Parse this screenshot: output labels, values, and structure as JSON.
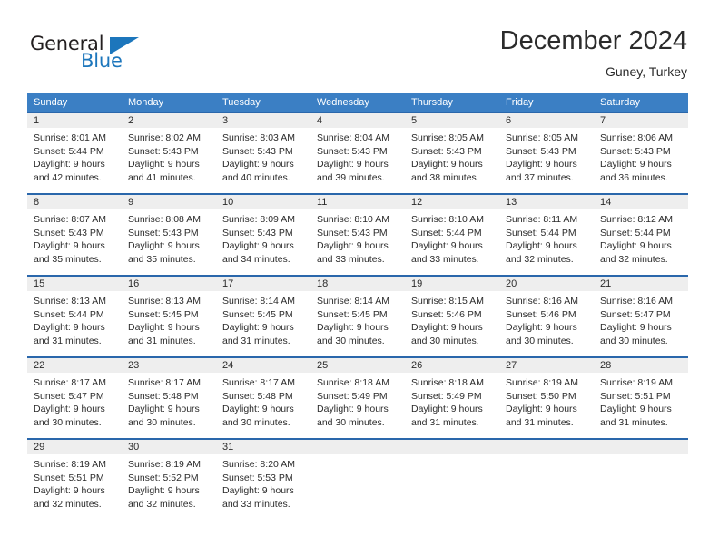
{
  "logo": {
    "word_top": "General",
    "word_bottom": "Blue",
    "triangle_color": "#1c76bc",
    "text_color": "#231f20"
  },
  "header": {
    "title": "December 2024",
    "location": "Guney, Turkey"
  },
  "theme": {
    "header_blue": "#3b7fc4",
    "cell_border_blue": "#2a67ab",
    "numband_gray": "#eeeeee",
    "text_color": "#2b2b2b"
  },
  "weekdays": [
    "Sunday",
    "Monday",
    "Tuesday",
    "Wednesday",
    "Thursday",
    "Friday",
    "Saturday"
  ],
  "weeks": [
    [
      {
        "day": "1",
        "sunrise": "Sunrise: 8:01 AM",
        "sunset": "Sunset: 5:44 PM",
        "daylight1": "Daylight: 9 hours",
        "daylight2": "and 42 minutes."
      },
      {
        "day": "2",
        "sunrise": "Sunrise: 8:02 AM",
        "sunset": "Sunset: 5:43 PM",
        "daylight1": "Daylight: 9 hours",
        "daylight2": "and 41 minutes."
      },
      {
        "day": "3",
        "sunrise": "Sunrise: 8:03 AM",
        "sunset": "Sunset: 5:43 PM",
        "daylight1": "Daylight: 9 hours",
        "daylight2": "and 40 minutes."
      },
      {
        "day": "4",
        "sunrise": "Sunrise: 8:04 AM",
        "sunset": "Sunset: 5:43 PM",
        "daylight1": "Daylight: 9 hours",
        "daylight2": "and 39 minutes."
      },
      {
        "day": "5",
        "sunrise": "Sunrise: 8:05 AM",
        "sunset": "Sunset: 5:43 PM",
        "daylight1": "Daylight: 9 hours",
        "daylight2": "and 38 minutes."
      },
      {
        "day": "6",
        "sunrise": "Sunrise: 8:05 AM",
        "sunset": "Sunset: 5:43 PM",
        "daylight1": "Daylight: 9 hours",
        "daylight2": "and 37 minutes."
      },
      {
        "day": "7",
        "sunrise": "Sunrise: 8:06 AM",
        "sunset": "Sunset: 5:43 PM",
        "daylight1": "Daylight: 9 hours",
        "daylight2": "and 36 minutes."
      }
    ],
    [
      {
        "day": "8",
        "sunrise": "Sunrise: 8:07 AM",
        "sunset": "Sunset: 5:43 PM",
        "daylight1": "Daylight: 9 hours",
        "daylight2": "and 35 minutes."
      },
      {
        "day": "9",
        "sunrise": "Sunrise: 8:08 AM",
        "sunset": "Sunset: 5:43 PM",
        "daylight1": "Daylight: 9 hours",
        "daylight2": "and 35 minutes."
      },
      {
        "day": "10",
        "sunrise": "Sunrise: 8:09 AM",
        "sunset": "Sunset: 5:43 PM",
        "daylight1": "Daylight: 9 hours",
        "daylight2": "and 34 minutes."
      },
      {
        "day": "11",
        "sunrise": "Sunrise: 8:10 AM",
        "sunset": "Sunset: 5:43 PM",
        "daylight1": "Daylight: 9 hours",
        "daylight2": "and 33 minutes."
      },
      {
        "day": "12",
        "sunrise": "Sunrise: 8:10 AM",
        "sunset": "Sunset: 5:44 PM",
        "daylight1": "Daylight: 9 hours",
        "daylight2": "and 33 minutes."
      },
      {
        "day": "13",
        "sunrise": "Sunrise: 8:11 AM",
        "sunset": "Sunset: 5:44 PM",
        "daylight1": "Daylight: 9 hours",
        "daylight2": "and 32 minutes."
      },
      {
        "day": "14",
        "sunrise": "Sunrise: 8:12 AM",
        "sunset": "Sunset: 5:44 PM",
        "daylight1": "Daylight: 9 hours",
        "daylight2": "and 32 minutes."
      }
    ],
    [
      {
        "day": "15",
        "sunrise": "Sunrise: 8:13 AM",
        "sunset": "Sunset: 5:44 PM",
        "daylight1": "Daylight: 9 hours",
        "daylight2": "and 31 minutes."
      },
      {
        "day": "16",
        "sunrise": "Sunrise: 8:13 AM",
        "sunset": "Sunset: 5:45 PM",
        "daylight1": "Daylight: 9 hours",
        "daylight2": "and 31 minutes."
      },
      {
        "day": "17",
        "sunrise": "Sunrise: 8:14 AM",
        "sunset": "Sunset: 5:45 PM",
        "daylight1": "Daylight: 9 hours",
        "daylight2": "and 31 minutes."
      },
      {
        "day": "18",
        "sunrise": "Sunrise: 8:14 AM",
        "sunset": "Sunset: 5:45 PM",
        "daylight1": "Daylight: 9 hours",
        "daylight2": "and 30 minutes."
      },
      {
        "day": "19",
        "sunrise": "Sunrise: 8:15 AM",
        "sunset": "Sunset: 5:46 PM",
        "daylight1": "Daylight: 9 hours",
        "daylight2": "and 30 minutes."
      },
      {
        "day": "20",
        "sunrise": "Sunrise: 8:16 AM",
        "sunset": "Sunset: 5:46 PM",
        "daylight1": "Daylight: 9 hours",
        "daylight2": "and 30 minutes."
      },
      {
        "day": "21",
        "sunrise": "Sunrise: 8:16 AM",
        "sunset": "Sunset: 5:47 PM",
        "daylight1": "Daylight: 9 hours",
        "daylight2": "and 30 minutes."
      }
    ],
    [
      {
        "day": "22",
        "sunrise": "Sunrise: 8:17 AM",
        "sunset": "Sunset: 5:47 PM",
        "daylight1": "Daylight: 9 hours",
        "daylight2": "and 30 minutes."
      },
      {
        "day": "23",
        "sunrise": "Sunrise: 8:17 AM",
        "sunset": "Sunset: 5:48 PM",
        "daylight1": "Daylight: 9 hours",
        "daylight2": "and 30 minutes."
      },
      {
        "day": "24",
        "sunrise": "Sunrise: 8:17 AM",
        "sunset": "Sunset: 5:48 PM",
        "daylight1": "Daylight: 9 hours",
        "daylight2": "and 30 minutes."
      },
      {
        "day": "25",
        "sunrise": "Sunrise: 8:18 AM",
        "sunset": "Sunset: 5:49 PM",
        "daylight1": "Daylight: 9 hours",
        "daylight2": "and 30 minutes."
      },
      {
        "day": "26",
        "sunrise": "Sunrise: 8:18 AM",
        "sunset": "Sunset: 5:49 PM",
        "daylight1": "Daylight: 9 hours",
        "daylight2": "and 31 minutes."
      },
      {
        "day": "27",
        "sunrise": "Sunrise: 8:19 AM",
        "sunset": "Sunset: 5:50 PM",
        "daylight1": "Daylight: 9 hours",
        "daylight2": "and 31 minutes."
      },
      {
        "day": "28",
        "sunrise": "Sunrise: 8:19 AM",
        "sunset": "Sunset: 5:51 PM",
        "daylight1": "Daylight: 9 hours",
        "daylight2": "and 31 minutes."
      }
    ],
    [
      {
        "day": "29",
        "sunrise": "Sunrise: 8:19 AM",
        "sunset": "Sunset: 5:51 PM",
        "daylight1": "Daylight: 9 hours",
        "daylight2": "and 32 minutes."
      },
      {
        "day": "30",
        "sunrise": "Sunrise: 8:19 AM",
        "sunset": "Sunset: 5:52 PM",
        "daylight1": "Daylight: 9 hours",
        "daylight2": "and 32 minutes."
      },
      {
        "day": "31",
        "sunrise": "Sunrise: 8:20 AM",
        "sunset": "Sunset: 5:53 PM",
        "daylight1": "Daylight: 9 hours",
        "daylight2": "and 33 minutes."
      },
      {
        "day": "",
        "sunrise": "",
        "sunset": "",
        "daylight1": "",
        "daylight2": ""
      },
      {
        "day": "",
        "sunrise": "",
        "sunset": "",
        "daylight1": "",
        "daylight2": ""
      },
      {
        "day": "",
        "sunrise": "",
        "sunset": "",
        "daylight1": "",
        "daylight2": ""
      },
      {
        "day": "",
        "sunrise": "",
        "sunset": "",
        "daylight1": "",
        "daylight2": ""
      }
    ]
  ]
}
